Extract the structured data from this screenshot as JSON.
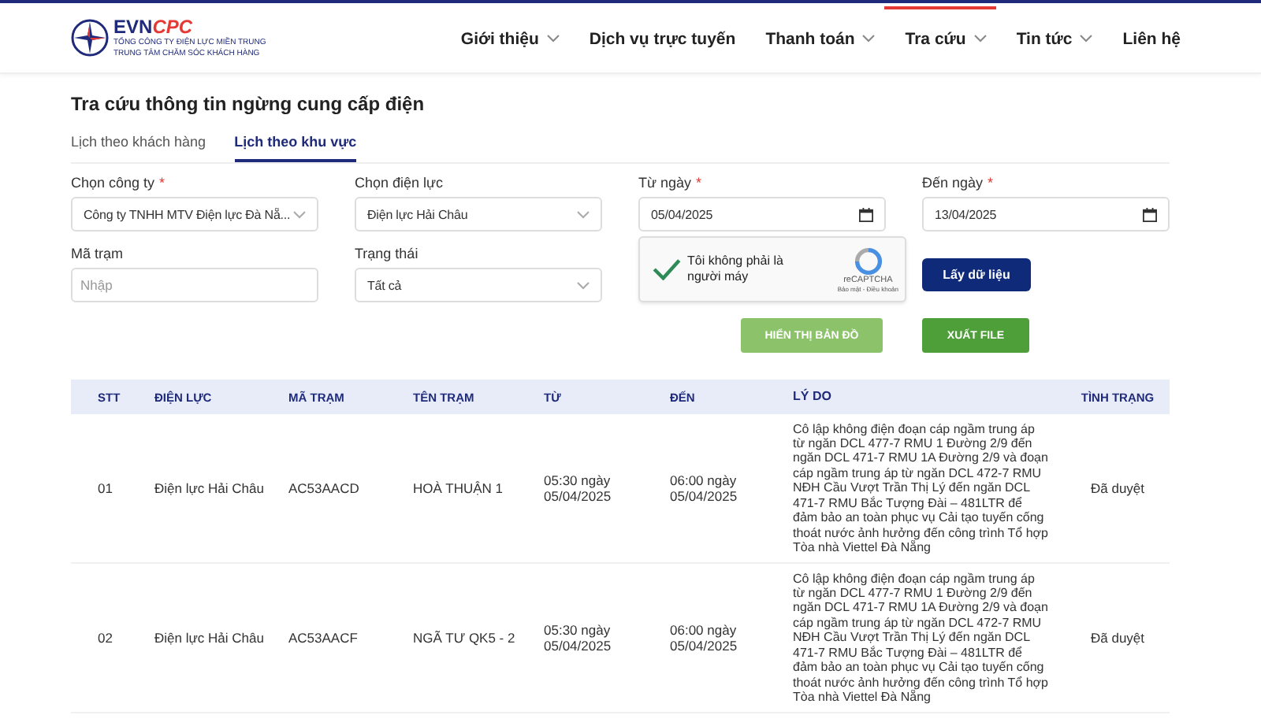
{
  "header": {
    "logo": {
      "brand_a": "EVN",
      "brand_b": "CPC",
      "line_1": "TỔNG CÔNG TY ĐIỆN LỰC MIỀN TRUNG",
      "line_2": "TRUNG TÂM CHĂM SÓC KHÁCH HÀNG"
    },
    "nav": [
      {
        "label": "Giới thiệu",
        "has_menu": true,
        "selected": false
      },
      {
        "label": "Dịch vụ trực tuyến",
        "has_menu": false,
        "selected": false
      },
      {
        "label": "Thanh toán",
        "has_menu": true,
        "selected": false
      },
      {
        "label": "Tra cứu",
        "has_menu": true,
        "selected": true
      },
      {
        "label": "Tin tức",
        "has_menu": true,
        "selected": false
      },
      {
        "label": "Liên hệ",
        "has_menu": false,
        "selected": false
      }
    ]
  },
  "page_title": "Tra cứu thông tin ngừng cung cấp điện",
  "tabs": [
    {
      "label": "Lịch theo khách hàng",
      "selected": false
    },
    {
      "label": "Lịch theo khu vực",
      "selected": true
    }
  ],
  "form": {
    "fields": [
      {
        "kind": "select",
        "label": "Chọn công ty",
        "required_mark": "*",
        "value": "Công ty TNHH MTV Điện lực Đà Nẵ..."
      },
      {
        "kind": "select",
        "label": "Chọn điện lực",
        "value": "Điện lực Hải Châu"
      },
      {
        "kind": "date",
        "label": "Từ ngày",
        "required_mark": "*",
        "value": "05/04/2025"
      },
      {
        "kind": "date",
        "label": "Đến ngày",
        "required_mark": "*",
        "value": "13/04/2025"
      },
      {
        "kind": "text",
        "label": "Mã trạm",
        "placeholder": "Nhập"
      },
      {
        "kind": "select",
        "label": "Trạng thái",
        "value": "Tất cả"
      }
    ],
    "captcha": {
      "checked": true,
      "label": "Tôi không phải là người máy",
      "brand": "reCAPTCHA",
      "links": "Bảo mật - Điều khoản"
    },
    "submit": "Lấy dữ liệu",
    "actions": [
      {
        "label": "HIỂN THỊ BẢN ĐỒ",
        "color": "#8cc36a"
      },
      {
        "label": "XUẤT FILE",
        "color": "#4e9e3a"
      }
    ]
  },
  "table": {
    "columns": [
      "STT",
      "ĐIỆN LỰC",
      "MÃ TRẠM",
      "TÊN TRẠM",
      "TỪ",
      "ĐẾN",
      "LÝ DO",
      "TÌNH TRẠNG"
    ],
    "rows": [
      [
        "01",
        "Điện lực Hải Châu",
        "AC53AACD",
        "HOÀ THUẬN 1",
        "05:30 ngày 05/04/2025",
        "06:00 ngày 05/04/2025",
        "Cô lập không điện đoạn cáp ngầm trung áp từ ngăn DCL 477-7 RMU 1 Đường 2/9 đến ngăn DCL 471-7 RMU 1A Đường 2/9 và đoạn cáp ngầm trung áp từ ngăn DCL 472-7 RMU NĐH Cầu Vượt Trần Thị Lý đến ngăn DCL 471-7 RMU Bắc Tượng Đài – 481LTR để đảm bảo an toàn phục vụ Cải tạo tuyến cống thoát nước ảnh hưởng đến công trình Tổ hợp Tòa nhà Viettel Đà Nẵng",
        "Đã duyệt"
      ],
      [
        "02",
        "Điện lực Hải Châu",
        "AC53AACF",
        "NGÃ TƯ QK5 - 2",
        "05:30 ngày 05/04/2025",
        "06:00 ngày 05/04/2025",
        "Cô lập không điện đoạn cáp ngầm trung áp từ ngăn DCL 477-7 RMU 1 Đường 2/9 đến ngăn DCL 471-7 RMU 1A Đường 2/9 và đoạn cáp ngầm trung áp từ ngăn DCL 472-7 RMU NĐH Cầu Vượt Trần Thị Lý đến ngăn DCL 471-7 RMU Bắc Tượng Đài – 481LTR để đảm bảo an toàn phục vụ Cải tạo tuyến cống thoát nước ảnh hưởng đến công trình Tổ hợp Tòa nhà Viettel Đà Nẵng",
        "Đã duyệt"
      ]
    ]
  }
}
